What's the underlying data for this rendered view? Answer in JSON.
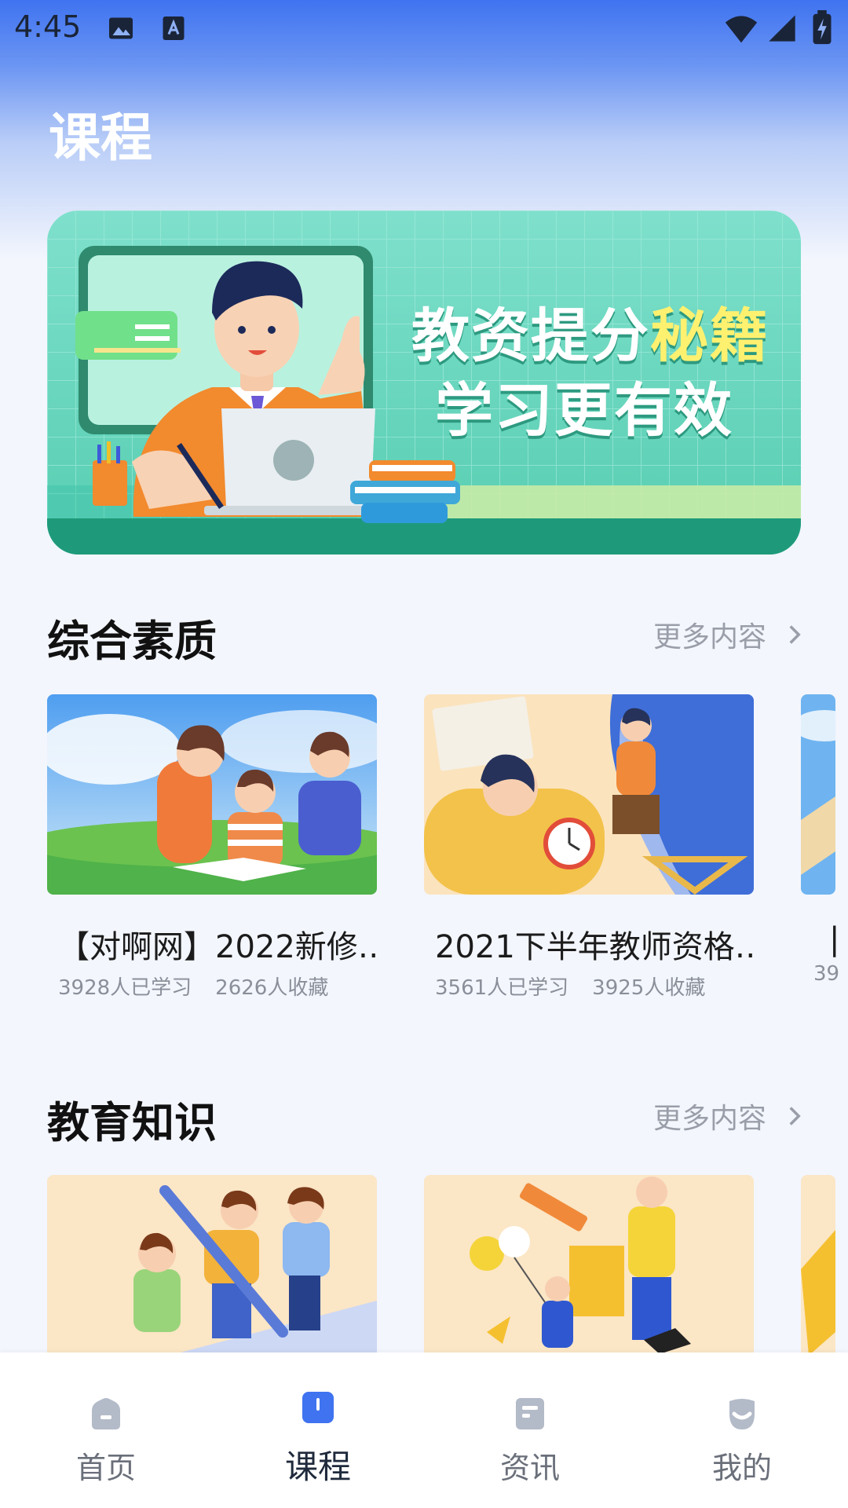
{
  "status_bar": {
    "time": "4:45"
  },
  "page": {
    "title": "课程"
  },
  "banner": {
    "line1_prefix": "教资提分",
    "line1_highlight": "秘籍",
    "line2": "学习更有效"
  },
  "sections": [
    {
      "title": "综合素质",
      "more_label": "更多内容",
      "cards": [
        {
          "title": "【对啊网】2022新修…",
          "learners": "3928人已学习",
          "favorites": "2626人收藏"
        },
        {
          "title": "2021下半年教师资格…",
          "learners": "3561人已学习",
          "favorites": "3925人收藏"
        },
        {
          "title": "|",
          "learners": "39",
          "favorites": ""
        }
      ]
    },
    {
      "title": "教育知识",
      "more_label": "更多内容"
    }
  ],
  "tabbar": {
    "items": [
      {
        "label": "首页",
        "icon": "home-icon"
      },
      {
        "label": "课程",
        "icon": "book-icon"
      },
      {
        "label": "资讯",
        "icon": "news-icon"
      },
      {
        "label": "我的",
        "icon": "profile-icon"
      }
    ],
    "active_index": 1
  },
  "colors": {
    "accent": "#3f73f0",
    "banner_green": "#56cdb0",
    "highlight_yellow": "#fff170"
  }
}
